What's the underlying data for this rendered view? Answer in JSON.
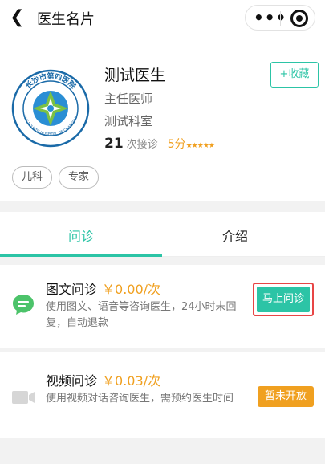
{
  "nav": {
    "title": "医生名片"
  },
  "doctor": {
    "name": "测试医生",
    "title": "主任医师",
    "department": "测试科室",
    "consult_count": "21",
    "consult_suffix": "次接诊",
    "score": "5分",
    "stars": "★★★★★",
    "favorite_label": "+收藏",
    "hospital_logo_text": "长沙市第四医院",
    "hospital_logo_en": "THE FOURTH HOSPITAL OF CHANGSHA",
    "tags": [
      "儿科",
      "专家"
    ]
  },
  "tabs": [
    {
      "label": "问诊",
      "active": true
    },
    {
      "label": "介绍",
      "active": false
    }
  ],
  "consults": [
    {
      "name": "图文问诊",
      "price": "￥0.00/次",
      "desc": "使用图文、语音等咨询医生，24小时未回复，自动退款",
      "button": "马上问诊",
      "icon": "chat-bubble-icon"
    },
    {
      "name": "视频问诊",
      "price": "￥0.03/次",
      "desc": "使用视频对话咨询医生，需预约医生时间",
      "button": "暂未开放",
      "icon": "video-camera-icon"
    }
  ],
  "colors": {
    "accent": "#2cc4a6",
    "price": "#f0a020",
    "highlight_border": "#e84545"
  }
}
